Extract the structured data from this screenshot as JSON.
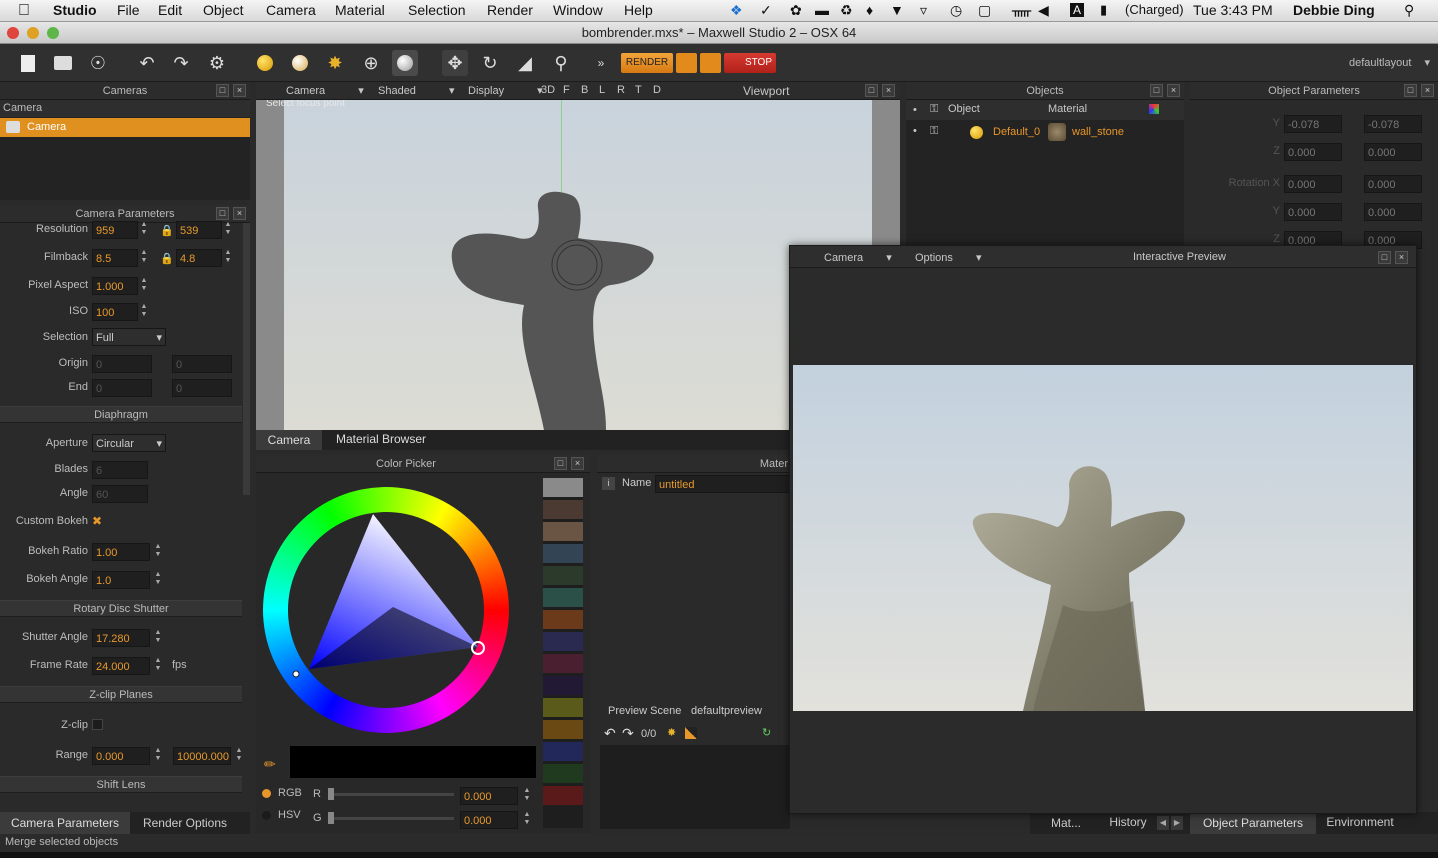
{
  "menubar": {
    "app": "Studio",
    "items": [
      "File",
      "Edit",
      "Object",
      "Camera",
      "Material",
      "Selection",
      "Render",
      "Window",
      "Help"
    ],
    "battery": "(Charged)",
    "clock": "Tue 3:43 PM",
    "user": "Debbie Ding"
  },
  "window": {
    "title": "bombrender.mxs* – Maxwell Studio 2 –  OSX 64"
  },
  "toolbar": {
    "render": "RENDER",
    "stop": "STOP",
    "layout": "defaultlayout"
  },
  "cameras_panel": {
    "title": "Cameras",
    "column": "Camera",
    "selected": "Camera"
  },
  "camera_params": {
    "title": "Camera Parameters",
    "resolution_label": "Resolution",
    "res_w": "959",
    "res_h": "539",
    "filmback_label": "Filmback",
    "film_w": "8.5",
    "film_h": "4.8",
    "pixel_aspect_label": "Pixel Aspect",
    "pixel_aspect": "1.000",
    "iso_label": "ISO",
    "iso": "100",
    "selection_label": "Selection",
    "selection": "Full",
    "origin_label": "Origin",
    "origin_x": "0",
    "origin_y": "0",
    "end_label": "End",
    "end_x": "0",
    "end_y": "0",
    "diaphragm": "Diaphragm",
    "aperture_label": "Aperture",
    "aperture": "Circular",
    "blades_label": "Blades",
    "blades": "6",
    "angle_label": "Angle",
    "angle": "60",
    "custom_bokeh_label": "Custom Bokeh",
    "bokeh_ratio_label": "Bokeh Ratio",
    "bokeh_ratio": "1.00",
    "bokeh_angle_label": "Bokeh Angle",
    "bokeh_angle": "1.0",
    "rotary": "Rotary Disc Shutter",
    "shutter_angle_label": "Shutter Angle",
    "shutter_angle": "17.280",
    "frame_rate_label": "Frame Rate",
    "frame_rate": "24.000",
    "fps": "fps",
    "zclip_section": "Z-clip Planes",
    "zclip_label": "Z-clip",
    "range_label": "Range",
    "range_min": "0.000",
    "range_max": "10000.000",
    "shift_lens": "Shift Lens"
  },
  "bottom_tabs": {
    "camera_params": "Camera Parameters",
    "render_options": "Render Options"
  },
  "status": "Merge selected objects",
  "viewport": {
    "camera_menu": "Camera",
    "shaded_menu": "Shaded",
    "display_menu": "Display",
    "view_buttons": [
      "3D",
      "F",
      "B",
      "L",
      "R",
      "T",
      "D"
    ],
    "title": "Viewport",
    "hint": "Select focus point"
  },
  "mid_tabs": {
    "camera": "Camera",
    "material_browser": "Material Browser"
  },
  "color_picker": {
    "title": "Color Picker",
    "rgb": "RGB",
    "hsv": "HSV",
    "r_label": "R",
    "g_label": "G",
    "r_value": "0.000",
    "g_value": "0.000"
  },
  "material_panel": {
    "title": "Mater",
    "name_label": "Name",
    "name_value": "untitled",
    "preview_scene_label": "Preview Scene",
    "preview_scene_value": "defaultpreview",
    "counter": "0/0"
  },
  "objects_panel": {
    "title": "Objects",
    "col_object": "Object",
    "col_material": "Material",
    "row_object": "Default_0",
    "row_material": "wall_stone"
  },
  "object_params": {
    "title": "Object Parameters",
    "y_label": "Y",
    "y1": "-0.078",
    "y2": "-0.078",
    "z_label": "Z",
    "z1": "0.000",
    "z2": "0.000",
    "rotx_label": "Rotation X",
    "rx1": "0.000",
    "rx2": "0.000",
    "ry_label": "Y",
    "ry1": "0.000",
    "ry2": "0.000",
    "rz_label": "Z",
    "rz1": "0.000",
    "rz2": "0.000"
  },
  "interactive_preview": {
    "camera_menu": "Camera",
    "options_menu": "Options",
    "title": "Interactive Preview"
  },
  "right_tabs": {
    "mat": "Mat...",
    "history": "History",
    "object_params": "Object Parameters",
    "environment": "Environment"
  },
  "colors": {
    "accent": "#e8972a",
    "render_btn": "#e38a1c",
    "stop_btn": "#c62b22"
  }
}
